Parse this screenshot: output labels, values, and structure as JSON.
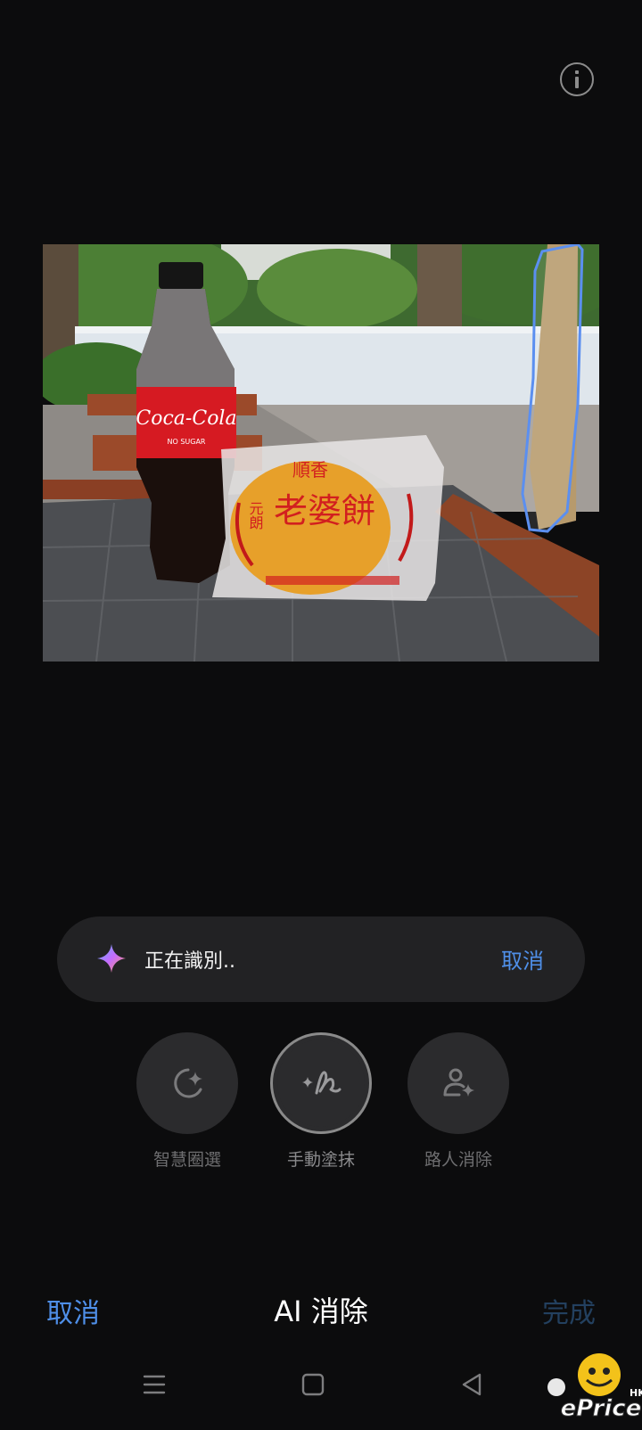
{
  "header": {
    "info_icon": "info-icon"
  },
  "status": {
    "icon": "sparkle-icon",
    "text": "正在識別..",
    "cancel_label": "取消"
  },
  "tools": [
    {
      "label": "智慧圈選",
      "icon": "smart-select-icon",
      "active": false
    },
    {
      "label": "手動塗抹",
      "icon": "brush-icon",
      "active": true
    },
    {
      "label": "路人消除",
      "icon": "remove-person-icon",
      "active": false
    }
  ],
  "footer": {
    "cancel_label": "取消",
    "title": "AI 消除",
    "done_label": "完成"
  },
  "photo": {
    "bottle_label": "Coca-Cola",
    "bottle_sublabel": "NO SUGAR",
    "package_top": "順香",
    "package_side": "元朗",
    "package_main": "老婆餅"
  },
  "nav": {
    "menu": "menu-icon",
    "home": "home-icon",
    "back": "back-icon"
  },
  "watermark": {
    "brand": "ePrice",
    "region": "HK"
  },
  "colors": {
    "accent": "#4f8fe8",
    "done_disabled": "#23405f",
    "selection": "#5b8ff0"
  }
}
